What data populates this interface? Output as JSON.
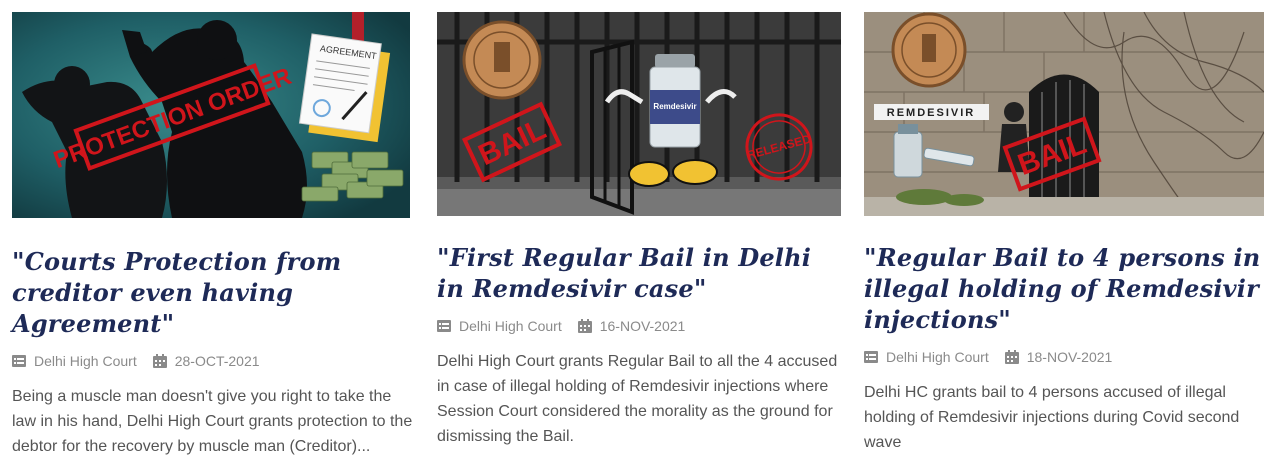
{
  "cards": [
    {
      "image_text": "PROTECTION ORDER",
      "agreement_text": "AGREEMENT",
      "title": "\"Courts Protection from creditor even having Agreement\"",
      "category": "Delhi High Court",
      "date": "28-OCT-2021",
      "excerpt": "Being a muscle man doesn't give you right to take the law in his hand, Delhi High Court grants protection to the debtor for the recovery by muscle man (Creditor)..."
    },
    {
      "image_text": "BAIL",
      "vial_text": "Remdesivir",
      "stamp_text": "RELEASED",
      "title": "\"First Regular Bail in Delhi in Remdesivir case\"",
      "category": "Delhi High Court",
      "date": "16-NOV-2021",
      "excerpt": "Delhi High Court grants Regular Bail to all the 4 accused in case of illegal holding of Remdesivir injections where Session Court considered the morality as the ground for dismissing the Bail."
    },
    {
      "image_text": "BAIL",
      "label_text": "REMDESIVIR",
      "title": "\"Regular Bail to 4 persons in illegal holding of Remdesivir injections\"",
      "category": "Delhi High Court",
      "date": "18-NOV-2021",
      "excerpt": "Delhi HC grants bail to 4 persons accused of illegal holding of Remdesivir injections during Covid second wave"
    }
  ],
  "icons": {
    "category": "list-icon",
    "date": "calendar-icon"
  },
  "colors": {
    "title": "#1e2a57",
    "meta": "#8a8a8a",
    "excerpt": "#555555",
    "stamp_red": "#d0151b"
  }
}
